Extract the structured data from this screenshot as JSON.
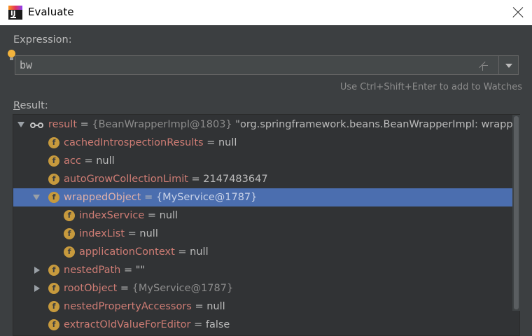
{
  "window": {
    "title": "Evaluate"
  },
  "expression": {
    "label": "Expression:",
    "value": "bw",
    "hint": "Use Ctrl+Shift+Enter to add to Watches"
  },
  "result": {
    "label_first": "R",
    "label_rest": "esult:",
    "rows": [
      {
        "name": "result",
        "eq": " = ",
        "type": "{BeanWrapperImpl@1803}",
        "value": " \"org.springframework.beans.BeanWrapperImpl: wrapping"
      },
      {
        "name": "cachedIntrospectionResults",
        "eq": " = ",
        "type": "",
        "value": "null"
      },
      {
        "name": "acc",
        "eq": " = ",
        "type": "",
        "value": "null"
      },
      {
        "name": "autoGrowCollectionLimit",
        "eq": " = ",
        "type": "",
        "value": "2147483647"
      },
      {
        "name": "wrappedObject",
        "eq": " = ",
        "type": "{MyService@1787}",
        "value": ""
      },
      {
        "name": "indexService",
        "eq": " = ",
        "type": "",
        "value": "null"
      },
      {
        "name": "indexList",
        "eq": " = ",
        "type": "",
        "value": "null"
      },
      {
        "name": "applicationContext",
        "eq": " = ",
        "type": "",
        "value": "null"
      },
      {
        "name": "nestedPath",
        "eq": " = ",
        "type": "",
        "value": "\"\""
      },
      {
        "name": "rootObject",
        "eq": " = ",
        "type": "{MyService@1787}",
        "value": ""
      },
      {
        "name": "nestedPropertyAccessors",
        "eq": " = ",
        "type": "",
        "value": "null"
      },
      {
        "name": "extractOldValueForEditor",
        "eq": " = ",
        "type": "",
        "value": "false"
      }
    ]
  },
  "icons": {
    "field": "f"
  }
}
